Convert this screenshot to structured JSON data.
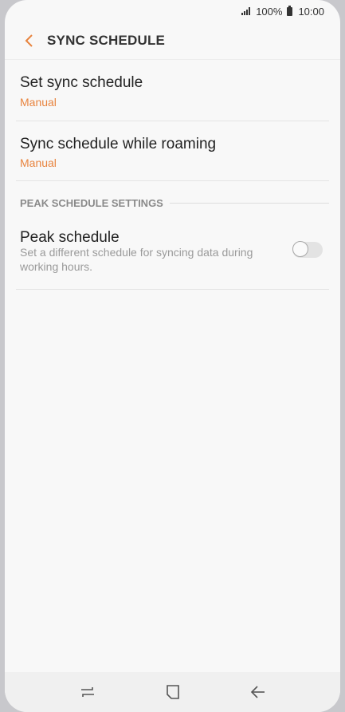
{
  "status_bar": {
    "battery": "100%",
    "time": "10:00"
  },
  "header": {
    "title": "SYNC SCHEDULE",
    "back_icon": "chevron-left-icon"
  },
  "settings": {
    "set_sync": {
      "title": "Set sync schedule",
      "value": "Manual"
    },
    "roaming": {
      "title": "Sync schedule while roaming",
      "value": "Manual"
    }
  },
  "peak_section": {
    "header": "PEAK SCHEDULE SETTINGS",
    "peak_schedule": {
      "title": "Peak schedule",
      "description": "Set a different schedule for syncing data during working hours.",
      "enabled": false
    }
  },
  "nav": {
    "recent_icon": "recent-apps-icon",
    "home_icon": "home-icon",
    "back_icon": "back-arrow-icon"
  },
  "colors": {
    "accent": "#e8843f",
    "background": "#f8f8f8"
  }
}
